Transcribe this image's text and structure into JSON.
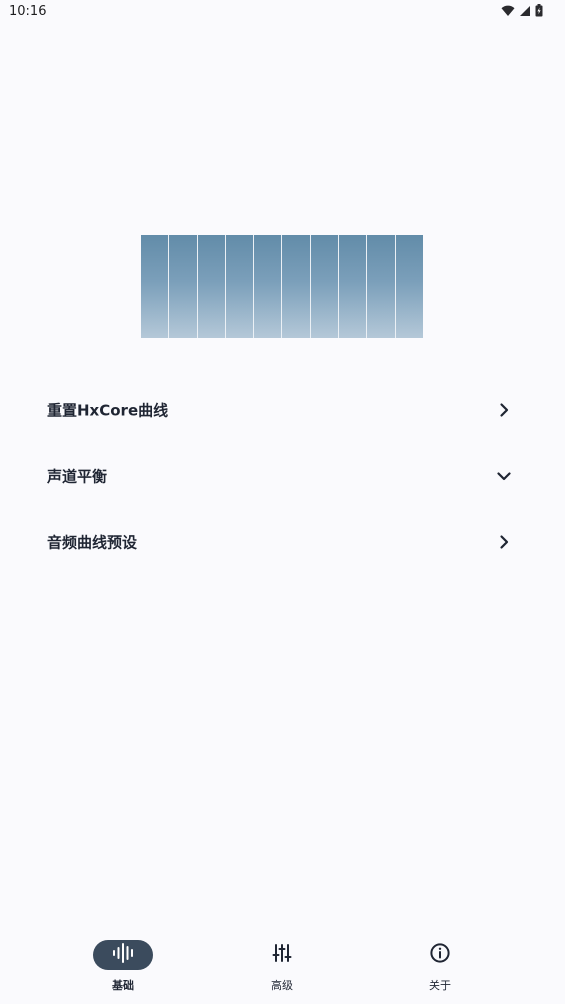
{
  "status_bar": {
    "time": "10:16",
    "icons": [
      "wifi-icon",
      "signal-icon",
      "battery-icon"
    ]
  },
  "equalizer_visual": {
    "band_count": 10,
    "gradient_colors": [
      "#628ca9",
      "#b4c8d8"
    ]
  },
  "menu": {
    "items": [
      {
        "label": "重置HxCore曲线",
        "chevron": "chevron-right-icon"
      },
      {
        "label": "声道平衡",
        "chevron": "chevron-down-icon"
      },
      {
        "label": "音频曲线预设",
        "chevron": "chevron-right-icon"
      }
    ]
  },
  "bottom_nav": {
    "active_index": 0,
    "active_color": "#3b4b5d",
    "items": [
      {
        "label": "基础",
        "icon": "waveform-icon"
      },
      {
        "label": "高级",
        "icon": "sliders-icon"
      },
      {
        "label": "关于",
        "icon": "info-icon"
      }
    ]
  }
}
